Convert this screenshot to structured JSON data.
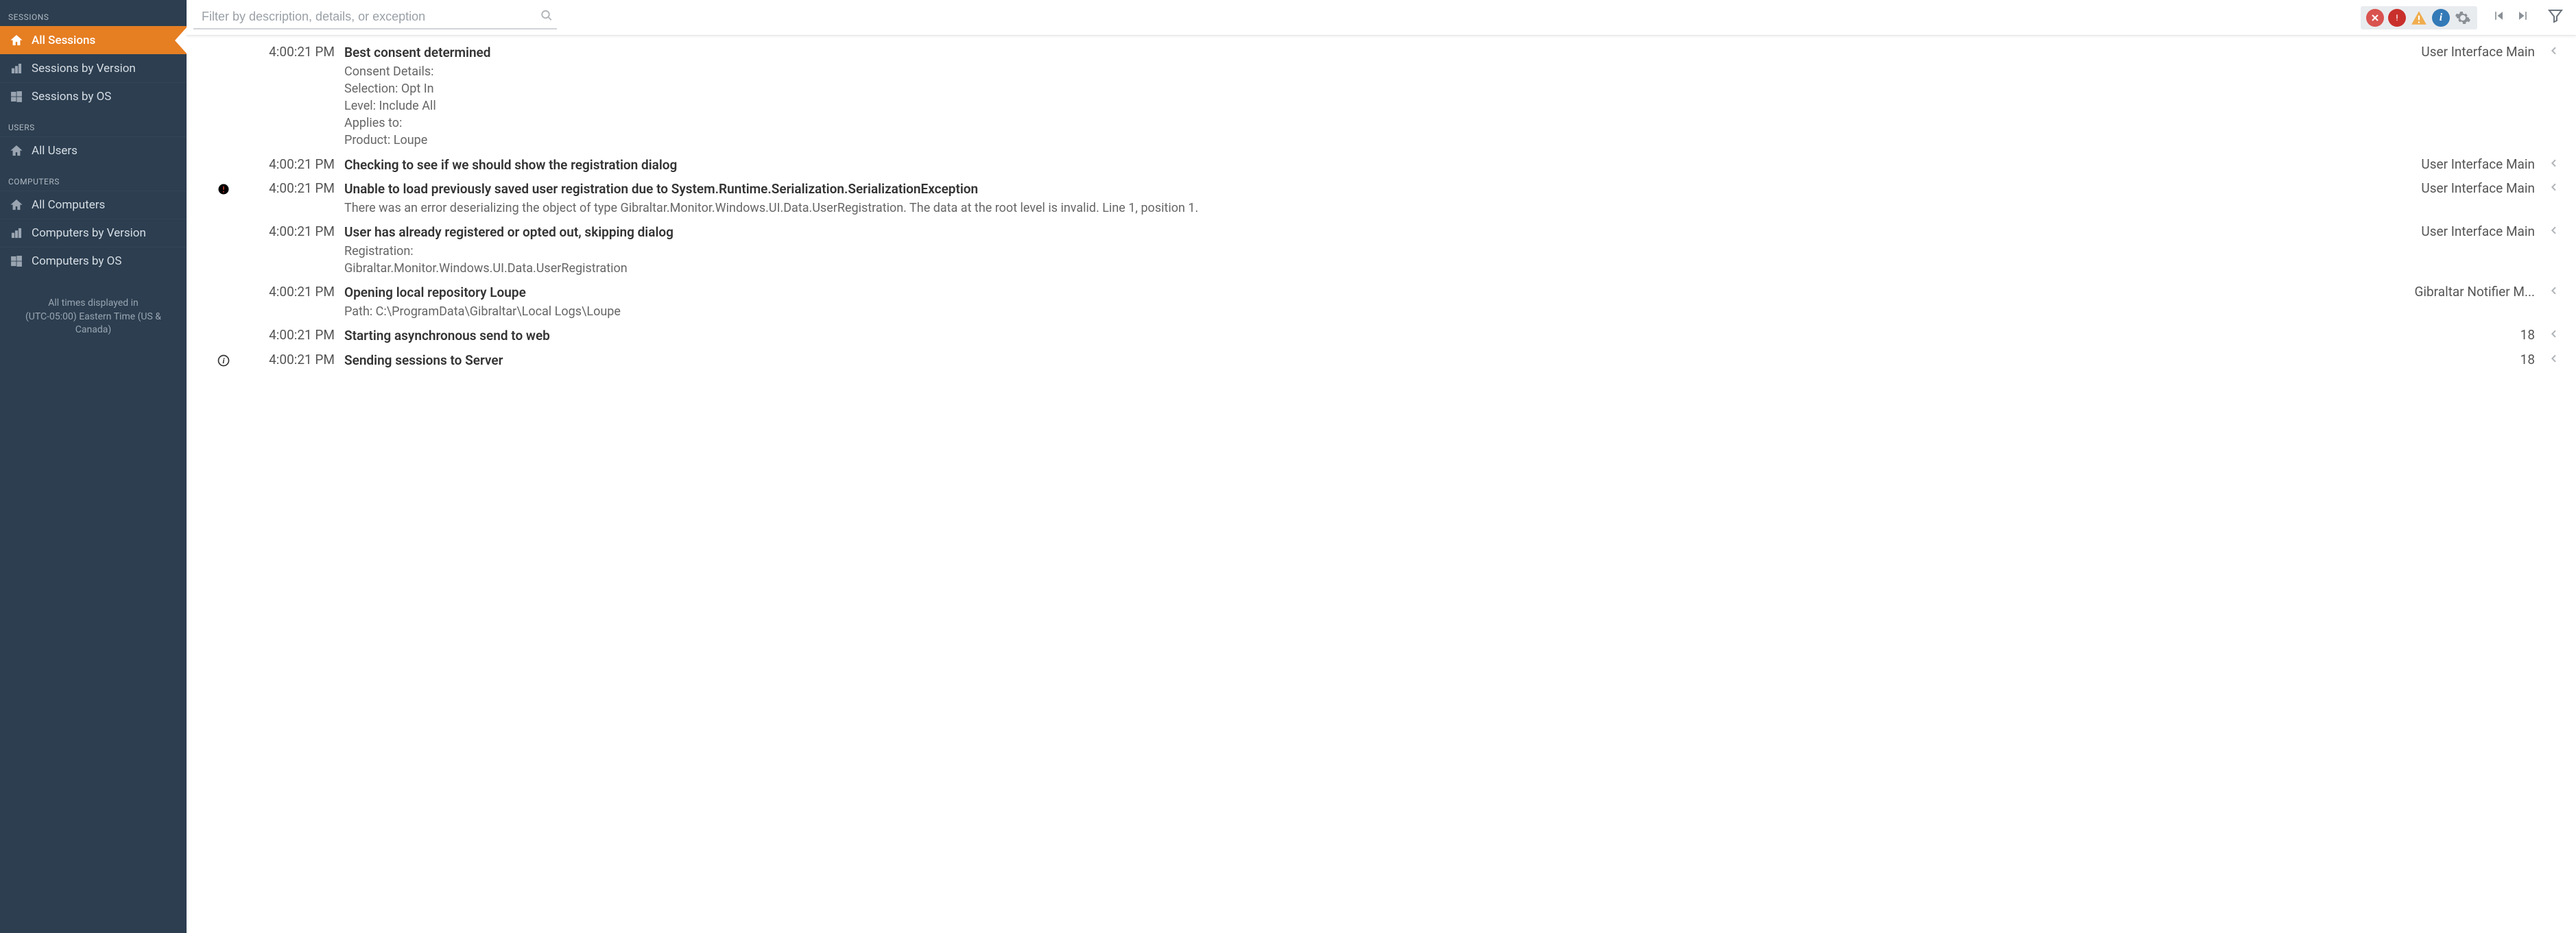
{
  "sidebar": {
    "sections": [
      {
        "header": "SESSIONS",
        "items": [
          {
            "label": "All Sessions",
            "icon": "home-icon",
            "active": true
          },
          {
            "label": "Sessions by Version",
            "icon": "bar-chart-icon",
            "active": false
          },
          {
            "label": "Sessions by OS",
            "icon": "windows-icon",
            "active": false
          }
        ]
      },
      {
        "header": "USERS",
        "items": [
          {
            "label": "All Users",
            "icon": "home-icon",
            "active": false
          }
        ]
      },
      {
        "header": "COMPUTERS",
        "items": [
          {
            "label": "All Computers",
            "icon": "home-icon",
            "active": false
          },
          {
            "label": "Computers by Version",
            "icon": "bar-chart-icon",
            "active": false
          },
          {
            "label": "Computers by OS",
            "icon": "windows-icon",
            "active": false
          }
        ]
      }
    ],
    "footer_line1": "All times displayed in",
    "footer_line2": "(UTC-05:00) Eastern Time (US & Canada)"
  },
  "toolbar": {
    "search_placeholder": "Filter by description, details, or exception"
  },
  "log_entries": [
    {
      "time": "4:00:21 PM",
      "caption": "Best consent determined",
      "details": "Consent Details:\nSelection: Opt In\nLevel: Include All\nApplies to:\n  Product: Loupe",
      "thread": "User Interface Main",
      "icon": null
    },
    {
      "time": "4:00:21 PM",
      "caption": "Checking to see if we should show the registration dialog",
      "details": "",
      "thread": "User Interface Main",
      "icon": null
    },
    {
      "time": "4:00:21 PM",
      "caption": "Unable to load previously saved user registration due to System.Runtime.Serialization.SerializationException",
      "details": "There was an error deserializing the object of type Gibraltar.Monitor.Windows.UI.Data.UserRegistration. The data at the root level is invalid. Line 1, position 1.",
      "thread": "User Interface Main",
      "icon": "warn"
    },
    {
      "time": "4:00:21 PM",
      "caption": "User has already registered or opted out, skipping dialog",
      "details": "Registration:\nGibraltar.Monitor.Windows.UI.Data.UserRegistration",
      "thread": "User Interface Main",
      "icon": null
    },
    {
      "time": "4:00:21 PM",
      "caption": "Opening local repository Loupe",
      "details": "Path: C:\\ProgramData\\Gibraltar\\Local Logs\\Loupe",
      "thread": "Gibraltar Notifier M...",
      "icon": null
    },
    {
      "time": "4:00:21 PM",
      "caption": "Starting asynchronous send to web",
      "details": "",
      "thread": "18",
      "icon": null
    },
    {
      "time": "4:00:21 PM",
      "caption": "Sending sessions to Server",
      "details": "",
      "thread": "18",
      "icon": "info"
    }
  ]
}
